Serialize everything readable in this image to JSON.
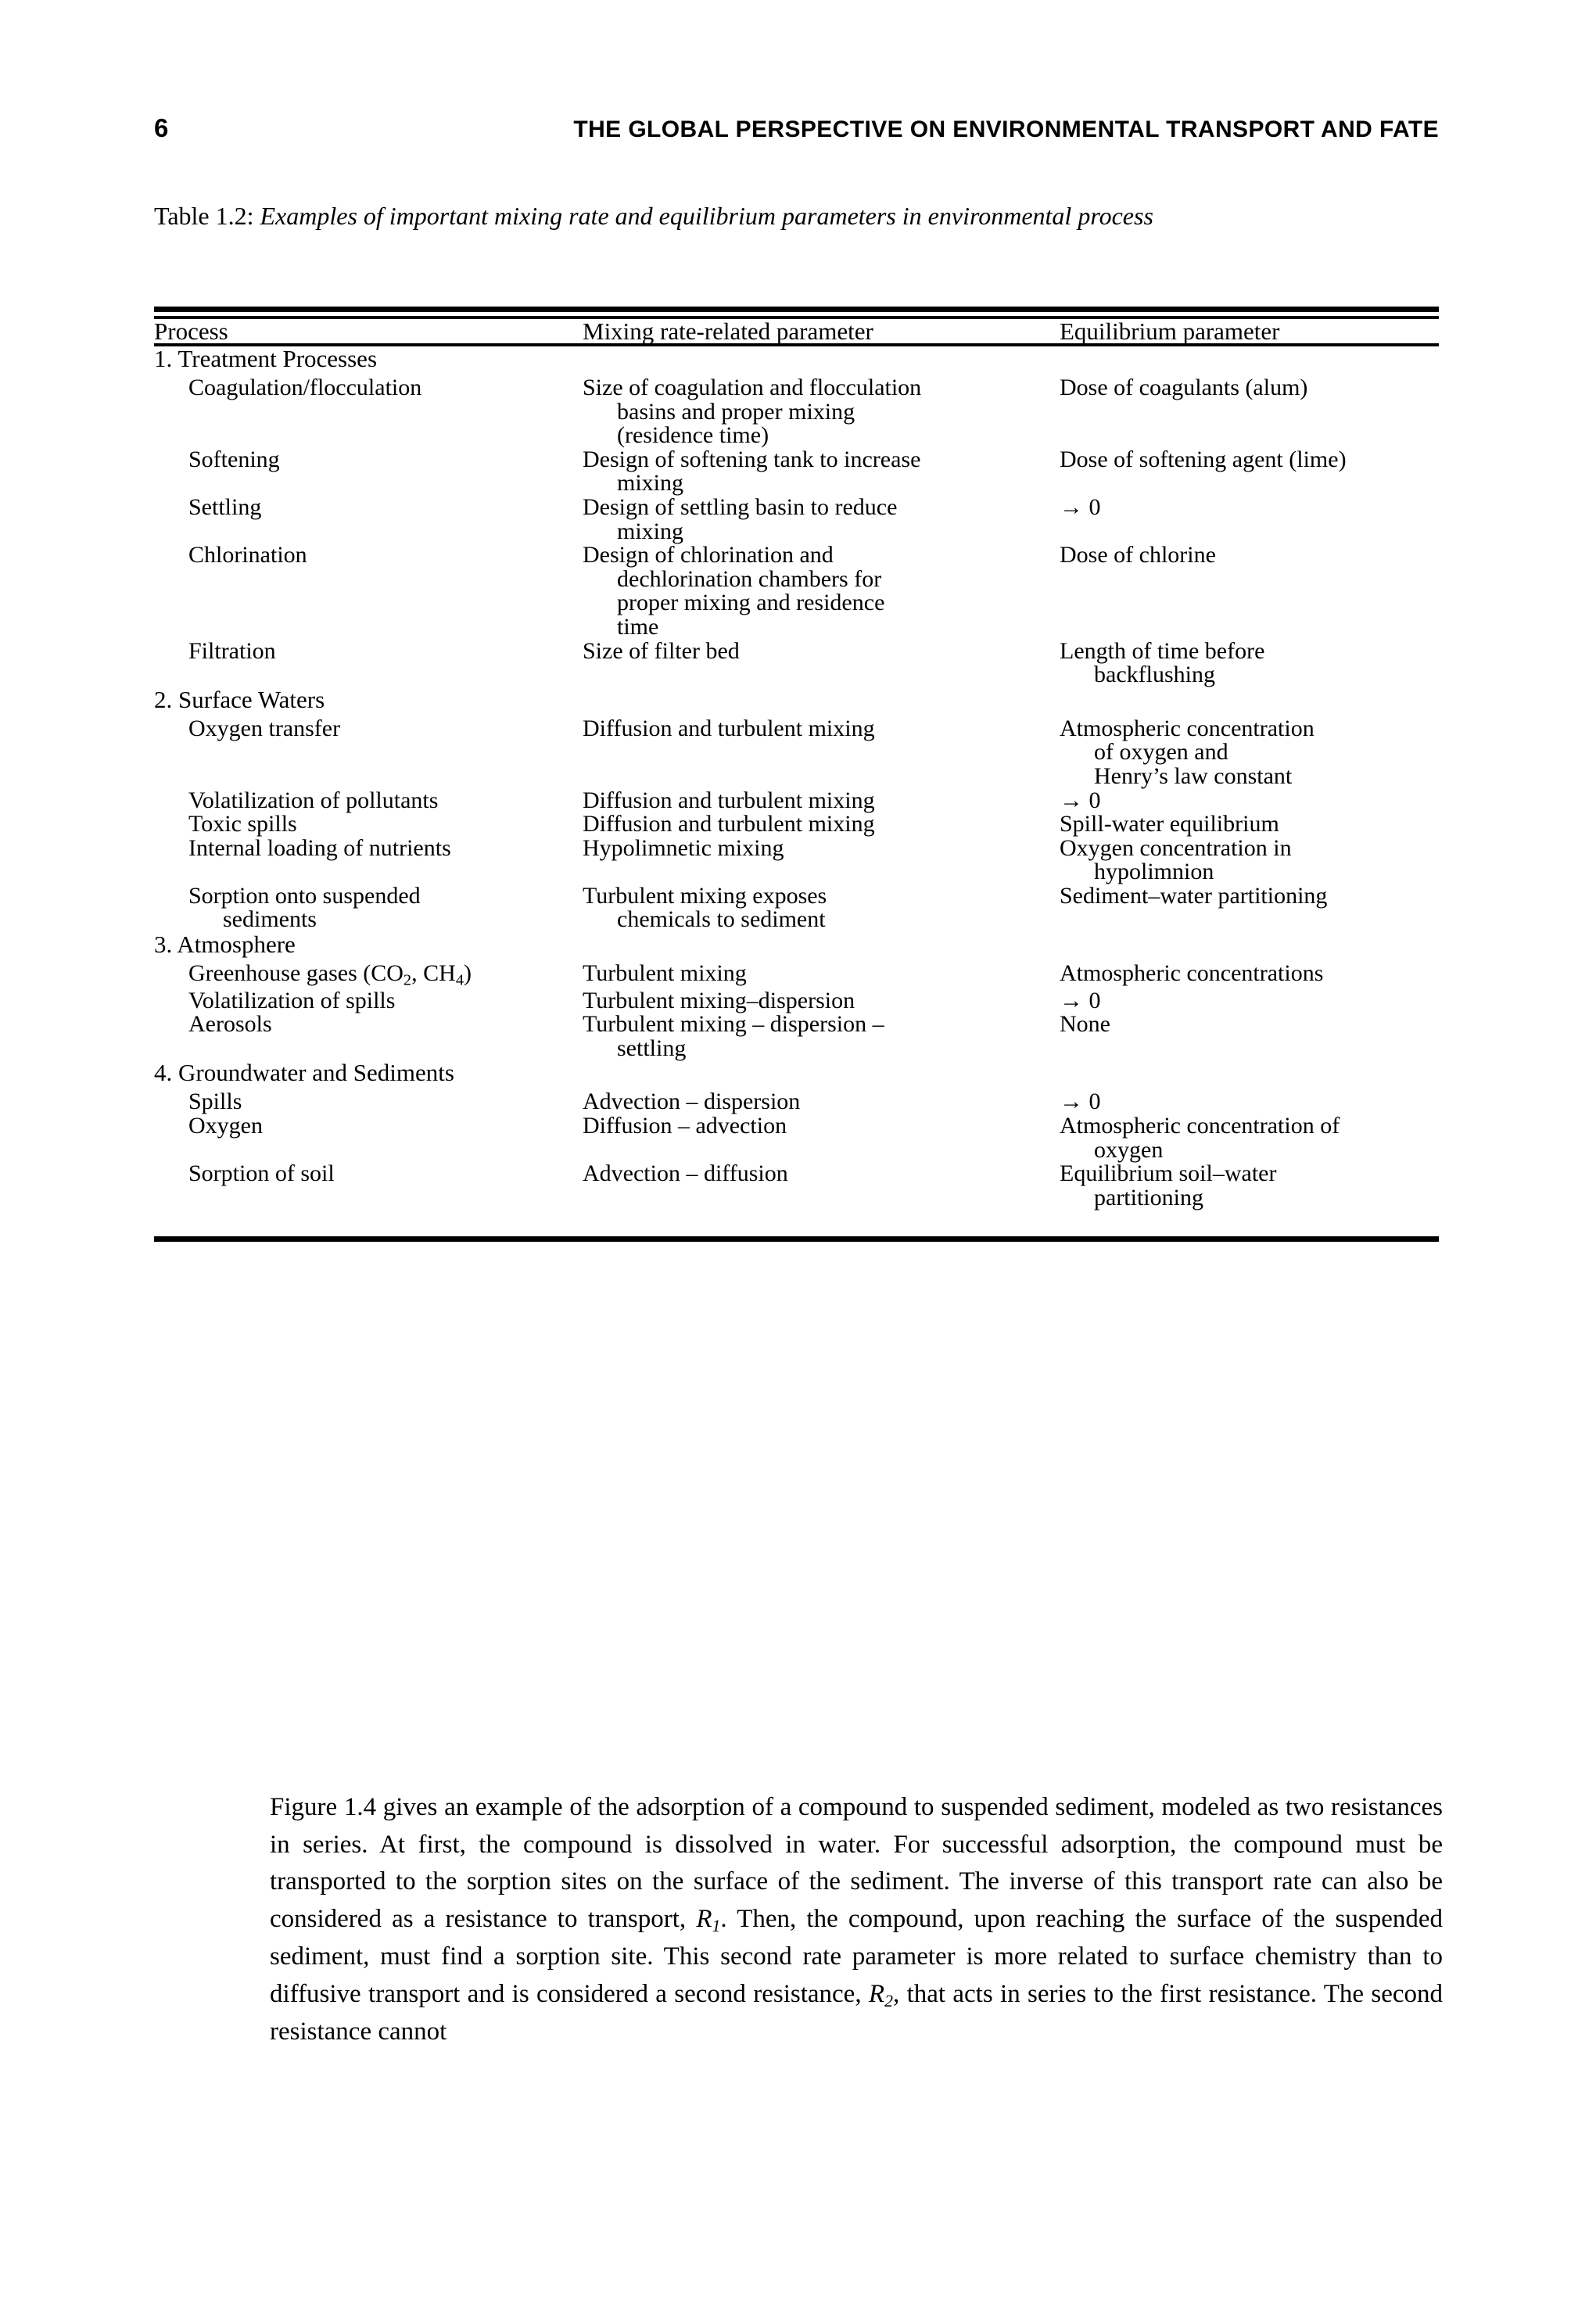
{
  "running_head": {
    "folio": "6",
    "title": "THE GLOBAL PERSPECTIVE ON ENVIRONMENTAL TRANSPORT AND FATE"
  },
  "caption": {
    "label": "Table 1.2:",
    "text": "Examples of important mixing rate and equilibrium parameters in environmental process"
  },
  "table": {
    "headers": {
      "col1": "Process",
      "col2": "Mixing rate-related parameter",
      "col3": "Equilibrium parameter"
    },
    "groups": [
      {
        "label": "1. Treatment Processes",
        "rows": [
          {
            "process": [
              "Coagulation/flocculation"
            ],
            "mixing": [
              "Size of coagulation and flocculation",
              "basins and proper mixing",
              "(residence time)"
            ],
            "equilibrium": [
              "Dose of coagulants (alum)"
            ]
          },
          {
            "process": [
              "Softening"
            ],
            "mixing": [
              "Design of softening tank to increase",
              "mixing"
            ],
            "equilibrium": [
              "Dose of softening agent (lime)"
            ]
          },
          {
            "process": [
              "Settling"
            ],
            "mixing": [
              "Design of settling basin to reduce",
              "mixing"
            ],
            "equilibrium": [
              "→ 0"
            ]
          },
          {
            "process": [
              "Chlorination"
            ],
            "mixing": [
              "Design of chlorination and",
              "dechlorination chambers for",
              "proper mixing and residence",
              "time"
            ],
            "equilibrium": [
              "Dose of chlorine"
            ]
          },
          {
            "process": [
              "Filtration"
            ],
            "mixing": [
              "Size of filter bed"
            ],
            "equilibrium": [
              "Length of time before",
              "backflushing"
            ]
          }
        ]
      },
      {
        "label": "2. Surface Waters",
        "rows": [
          {
            "process": [
              "Oxygen transfer"
            ],
            "mixing": [
              "Diffusion and turbulent mixing"
            ],
            "equilibrium": [
              "Atmospheric concentration",
              "of oxygen and",
              "Henry’s law constant"
            ]
          },
          {
            "process": [
              "Volatilization of pollutants"
            ],
            "mixing": [
              "Diffusion and turbulent mixing"
            ],
            "equilibrium": [
              "→ 0"
            ]
          },
          {
            "process": [
              "Toxic spills"
            ],
            "mixing": [
              "Diffusion and turbulent mixing"
            ],
            "equilibrium": [
              "Spill-water equilibrium"
            ]
          },
          {
            "process": [
              "Internal loading of nutrients"
            ],
            "mixing": [
              "Hypolimnetic mixing"
            ],
            "equilibrium": [
              "Oxygen concentration in",
              "hypolimnion"
            ]
          },
          {
            "process": [
              "Sorption onto suspended",
              "sediments"
            ],
            "mixing": [
              "Turbulent mixing exposes",
              "chemicals to sediment"
            ],
            "equilibrium": [
              "Sediment–water partitioning"
            ]
          }
        ]
      },
      {
        "label": "3. Atmosphere",
        "rows": [
          {
            "process_html": "Greenhouse gases (CO<span class=\"sub\">2</span>, CH<span class=\"sub\">4</span>)",
            "process": [
              "Greenhouse gases (CO2, CH4)"
            ],
            "mixing": [
              "Turbulent mixing"
            ],
            "equilibrium": [
              "Atmospheric concentrations"
            ]
          },
          {
            "process": [
              "Volatilization of spills"
            ],
            "mixing": [
              "Turbulent mixing–dispersion"
            ],
            "equilibrium": [
              "→ 0"
            ]
          },
          {
            "process": [
              "Aerosols"
            ],
            "mixing": [
              "Turbulent mixing – dispersion –",
              "settling"
            ],
            "equilibrium": [
              "None"
            ]
          }
        ]
      },
      {
        "label": "4. Groundwater and Sediments",
        "rows": [
          {
            "process": [
              "Spills"
            ],
            "mixing": [
              "Advection – dispersion"
            ],
            "equilibrium": [
              "→ 0"
            ]
          },
          {
            "process": [
              "Oxygen"
            ],
            "mixing": [
              "Diffusion – advection"
            ],
            "equilibrium": [
              "Atmospheric concentration of",
              "oxygen"
            ]
          },
          {
            "process": [
              "Sorption of soil"
            ],
            "mixing": [
              "Advection – diffusion"
            ],
            "equilibrium": [
              "Equilibrium soil–water",
              "partitioning"
            ]
          }
        ]
      }
    ]
  },
  "body_paragraph": {
    "part1": "Figure 1.4 gives an example of the adsorption of a compound to suspended sediment, modeled as two resistances in series. At first, the compound is dissolved in water. For successful adsorption, the compound must be transported to the sorption sites on the surface of the sediment. The inverse of this transport rate can also be considered as a resistance to transport, ",
    "r1": "R",
    "r1_sub": "1",
    "part2": ". Then, the compound, upon reaching the surface of the suspended sediment, must find a sorption site. This second rate parameter is more related to surface chemistry than to diffusive transport and is considered a second resistance, ",
    "r2": "R",
    "r2_sub": "2",
    "part3": ", that acts in series to the first resistance. The second resistance cannot"
  }
}
